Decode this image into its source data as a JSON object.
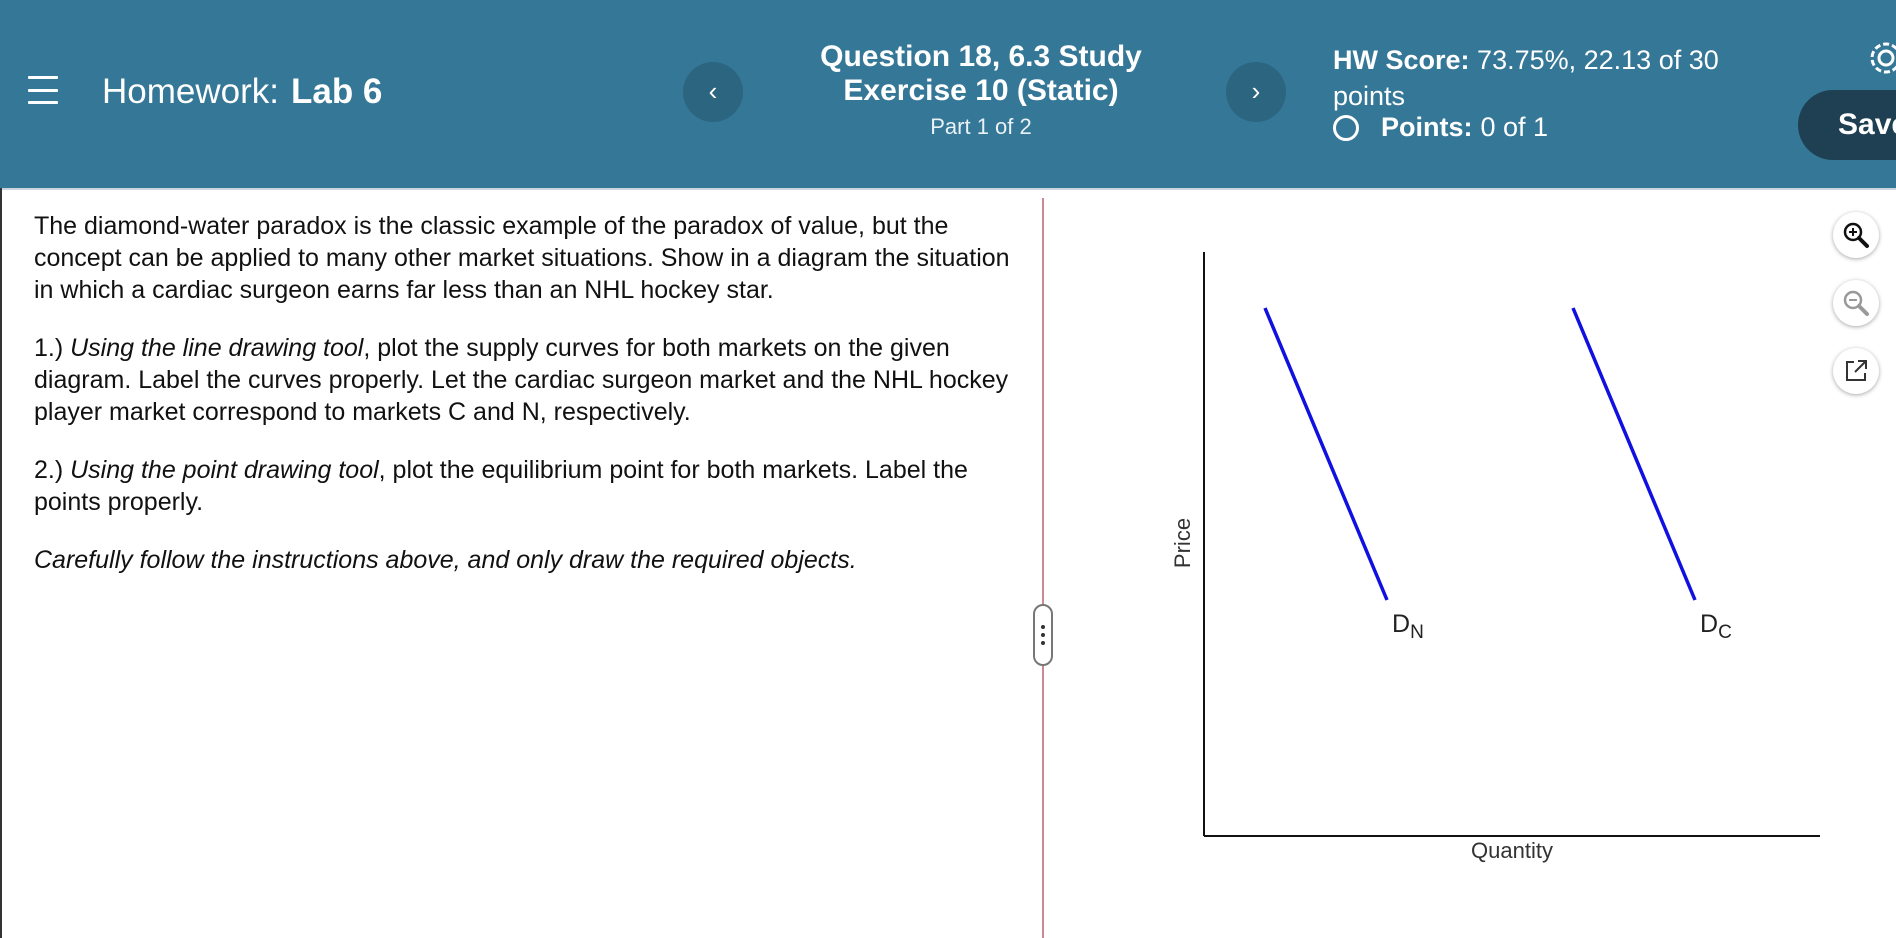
{
  "header": {
    "menu_icon": "hamburger-menu-icon",
    "homework_prefix": "Homework:",
    "homework_name": "Lab 6",
    "prev_label": "‹",
    "next_label": "›",
    "question_title_line1": "Question 18, 6.3 Study",
    "question_title_line2": "Exercise 10 (Static)",
    "question_part": "Part 1 of 2",
    "hw_score_label": "HW Score:",
    "hw_score_value": "73.75%, 22.13 of 30",
    "hw_score_unit": "points",
    "points_label": "Points:",
    "points_value": "0 of 1",
    "save_label": "Save",
    "settings_icon": "gear-icon"
  },
  "question": {
    "intro": "The diamond-water paradox is the classic example of the paradox of value, but the concept can be applied to many other market situations. Show in a diagram the situation in which a cardiac surgeon earns far less than an NHL hockey star.",
    "step1_prefix": "1.) ",
    "step1_italic": "Using the line drawing tool",
    "step1_rest": ", plot the supply curves for both markets on the given diagram. Label the curves properly. Let the cardiac surgeon market and the NHL hockey player market correspond to markets C and N, respectively.",
    "step2_prefix": "2.) ",
    "step2_italic": "Using the point drawing tool",
    "step2_rest": ", plot the equilibrium point for both markets. Label the points properly.",
    "note": "Carefully follow the instructions above, and only draw the required objects."
  },
  "graph": {
    "y_axis_label": "Price",
    "x_axis_label": "Quantity",
    "curves": [
      {
        "label_main": "D",
        "label_sub": "N",
        "color": "#1010e0"
      },
      {
        "label_main": "D",
        "label_sub": "C",
        "color": "#1010e0"
      }
    ]
  },
  "tools": {
    "zoom_in_icon": "zoom-in-icon",
    "zoom_out_icon": "zoom-out-icon",
    "popout_icon": "external-link-icon"
  },
  "colors": {
    "header_bg": "#357797",
    "nav_button_bg": "#2c6580",
    "save_button_bg": "#1f3f52",
    "curve": "#1010e0",
    "divider": "#c98a93"
  }
}
